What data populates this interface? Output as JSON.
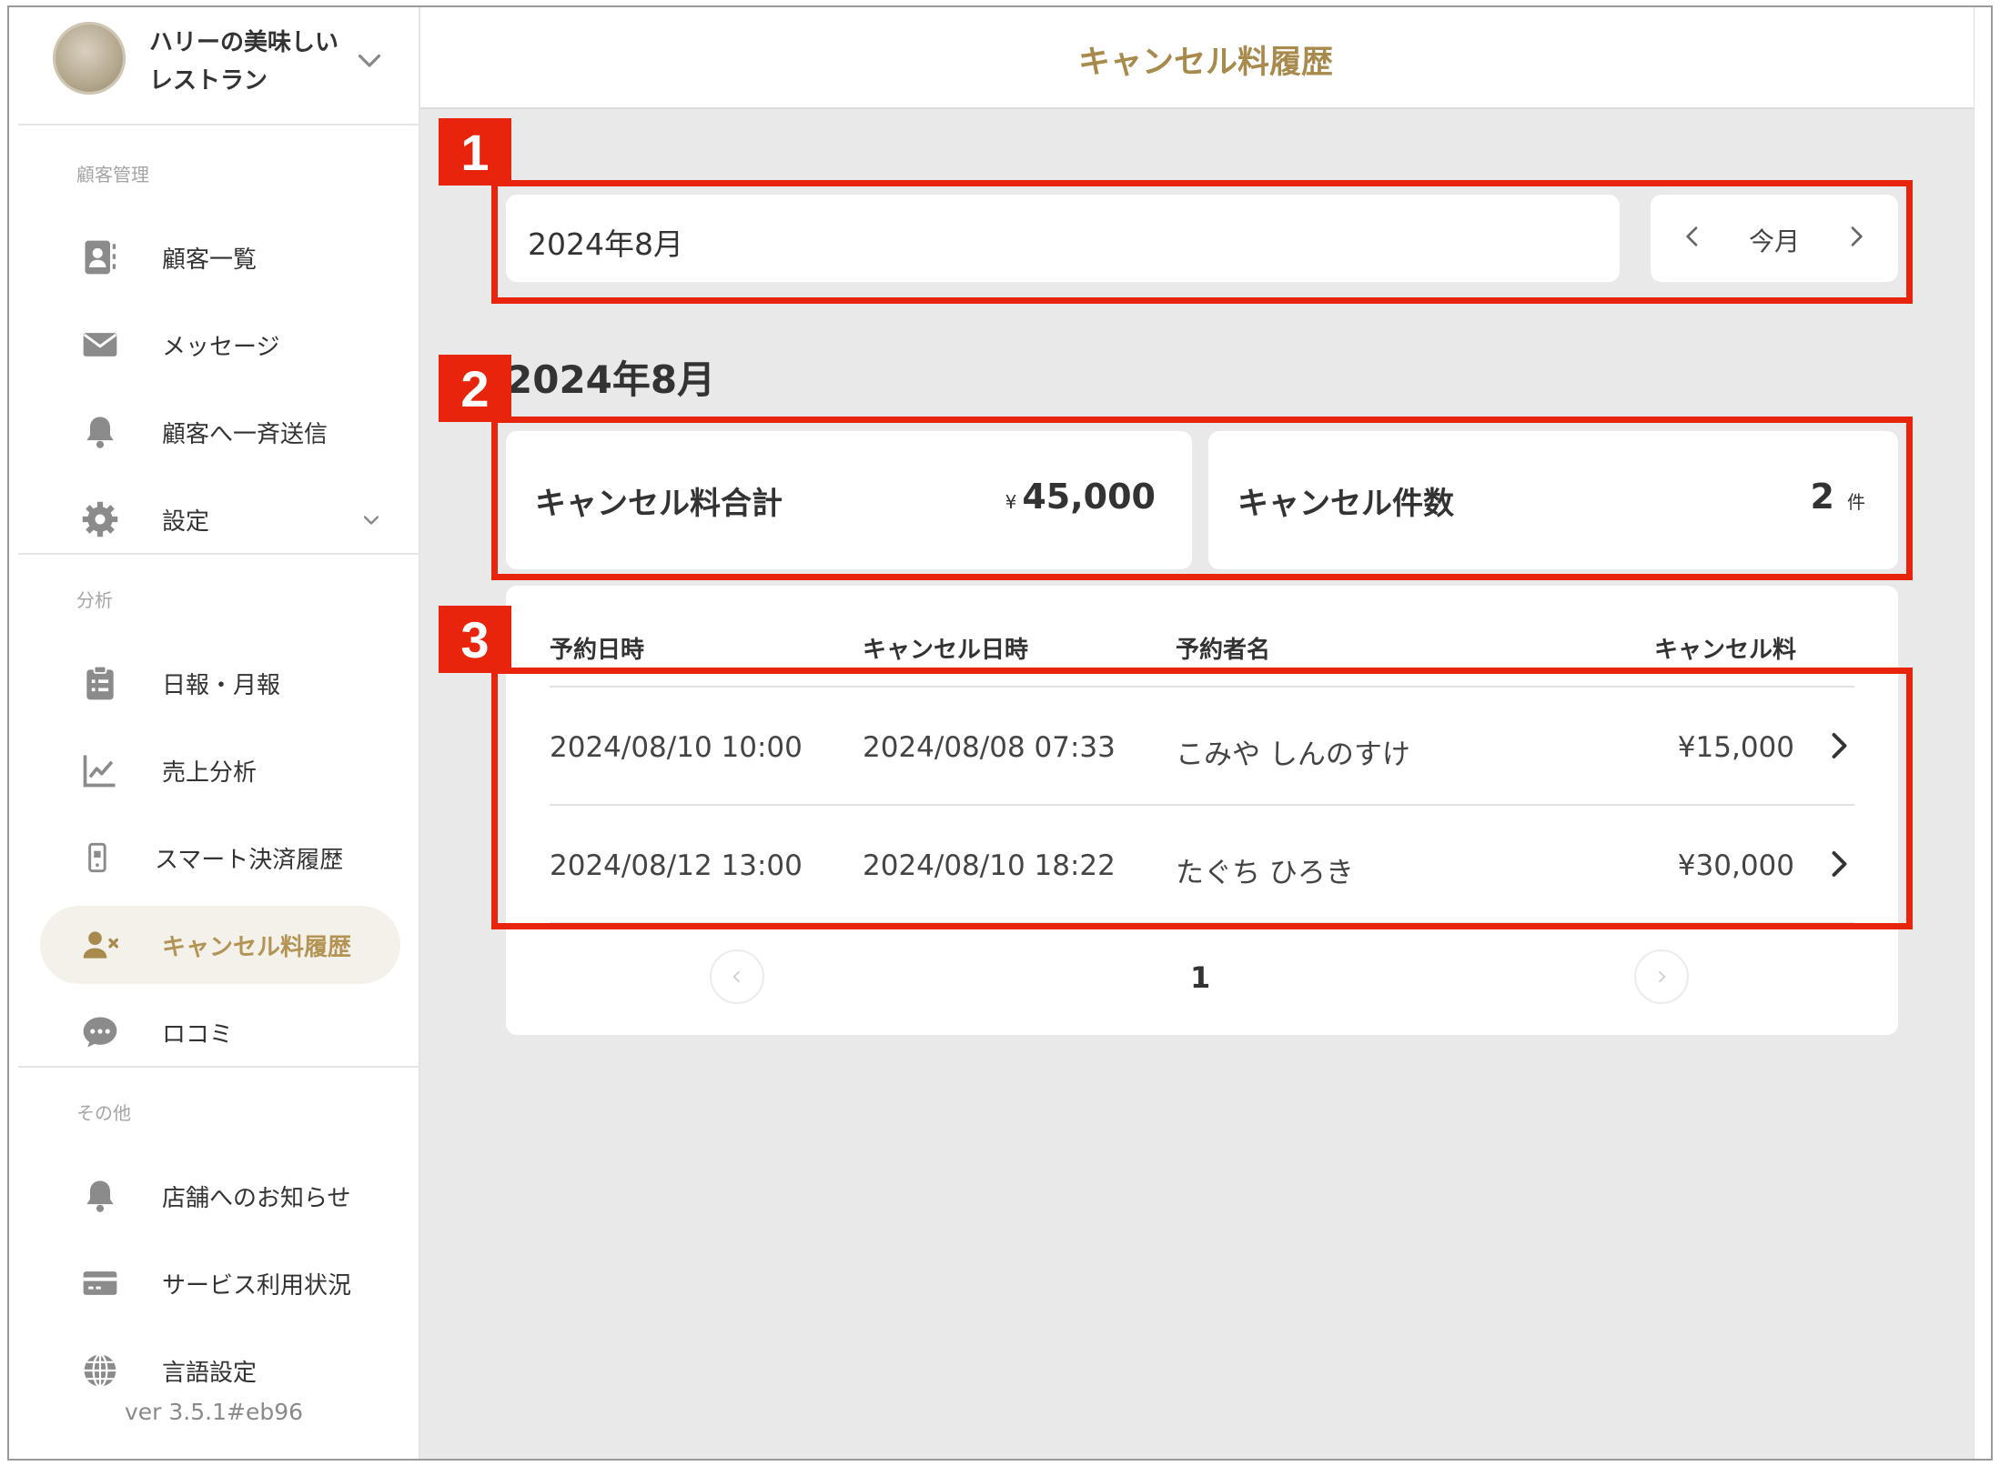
{
  "shop": {
    "name": "ハリーの美味しいレストラン"
  },
  "sidebar": {
    "sections": [
      {
        "label": "顧客管理"
      },
      {
        "label": "分析"
      },
      {
        "label": "その他"
      }
    ],
    "items": [
      {
        "label": "顧客一覧",
        "icon": "contact-card-icon"
      },
      {
        "label": "メッセージ",
        "icon": "envelope-icon"
      },
      {
        "label": "顧客へ一斉送信",
        "icon": "bell-icon"
      },
      {
        "label": "設定",
        "icon": "gear-icon"
      },
      {
        "label": "日報・月報",
        "icon": "clipboard-icon"
      },
      {
        "label": "売上分析",
        "icon": "line-chart-icon"
      },
      {
        "label": "スマート決済履歴",
        "icon": "phone-payment-icon"
      },
      {
        "label": "キャンセル料履歴",
        "icon": "user-cancel-icon",
        "active": true
      },
      {
        "label": "ロコミ",
        "icon": "chat-bubble-icon"
      },
      {
        "label": "店舗へのお知らせ",
        "icon": "bell-icon"
      },
      {
        "label": "サービス利用状況",
        "icon": "credit-card-icon"
      },
      {
        "label": "言語設定",
        "icon": "globe-icon"
      }
    ],
    "version": "ver 3.5.1#eb96"
  },
  "header": {
    "title": "キャンセル料履歴"
  },
  "filter": {
    "month_value": "2024年8月",
    "today_label": "今月"
  },
  "period_heading": "2024年8月",
  "stats": {
    "total": {
      "label": "キャンセル料合計",
      "currency": "¥",
      "value": "45,000"
    },
    "count": {
      "label": "キャンセル件数",
      "value": "2",
      "unit": "件"
    }
  },
  "table": {
    "columns": [
      "予約日時",
      "キャンセル日時",
      "予約者名",
      "キャンセル料"
    ],
    "rows": [
      {
        "reserved": "2024/08/10 10:00",
        "cancelled": "2024/08/08 07:33",
        "name": "こみや しんのすけ",
        "fee": "¥15,000"
      },
      {
        "reserved": "2024/08/12 13:00",
        "cancelled": "2024/08/10 18:22",
        "name": "たぐち ひろき",
        "fee": "¥30,000"
      }
    ]
  },
  "pagination": {
    "current": "1"
  },
  "annotations": [
    {
      "number": "1"
    },
    {
      "number": "2"
    },
    {
      "number": "3"
    }
  ],
  "colors": {
    "accent": "#a88a4c",
    "annotation": "#e8250c",
    "icon_gray": "#8b8b8b",
    "background": "#e9e9e9"
  }
}
